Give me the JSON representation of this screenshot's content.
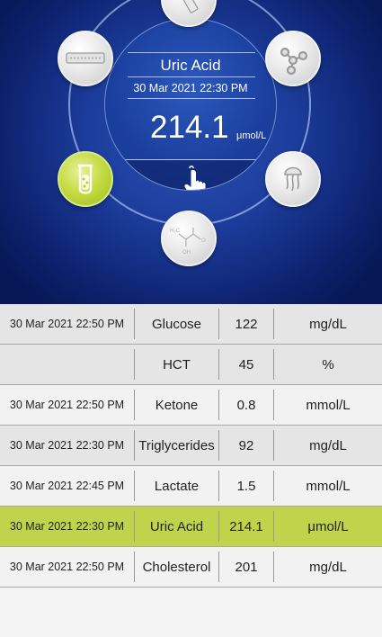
{
  "hero": {
    "title": "Uric Acid",
    "datetime": "30 Mar 2021 22:30 PM",
    "value": "214.1",
    "unit": "μmol/L",
    "accent": "#c2da3e",
    "orbs": [
      {
        "name": "test-strip-icon",
        "active": false
      },
      {
        "name": "molecule-icon",
        "active": false
      },
      {
        "name": "jellyfish-icon",
        "active": false
      },
      {
        "name": "lactate-formula-icon",
        "active": false
      },
      {
        "name": "blood-tube-icon",
        "active": true
      },
      {
        "name": "strip-cartridge-icon",
        "active": false
      }
    ]
  },
  "table": {
    "rows": [
      {
        "datetime": "30 Mar 2021 22:50 PM",
        "test": "Glucose",
        "value": "122",
        "unit": "mg/dL",
        "style": "shade"
      },
      {
        "datetime": "",
        "test": "HCT",
        "value": "45",
        "unit": "%",
        "style": "shade"
      },
      {
        "datetime": "30 Mar 2021 22:50 PM",
        "test": "Ketone",
        "value": "0.8",
        "unit": "mmol/L",
        "style": ""
      },
      {
        "datetime": "30 Mar 2021 22:30 PM",
        "test": "Triglycerides",
        "value": "92",
        "unit": "mg/dL",
        "style": "shade"
      },
      {
        "datetime": "30 Mar 2021 22:45 PM",
        "test": "Lactate",
        "value": "1.5",
        "unit": "mmol/L",
        "style": ""
      },
      {
        "datetime": "30 Mar 2021 22:30 PM",
        "test": "Uric Acid",
        "value": "214.1",
        "unit": "μmol/L",
        "style": "hl"
      },
      {
        "datetime": "30 Mar 2021 22:50 PM",
        "test": "Cholesterol",
        "value": "201",
        "unit": "mg/dL",
        "style": ""
      }
    ]
  }
}
